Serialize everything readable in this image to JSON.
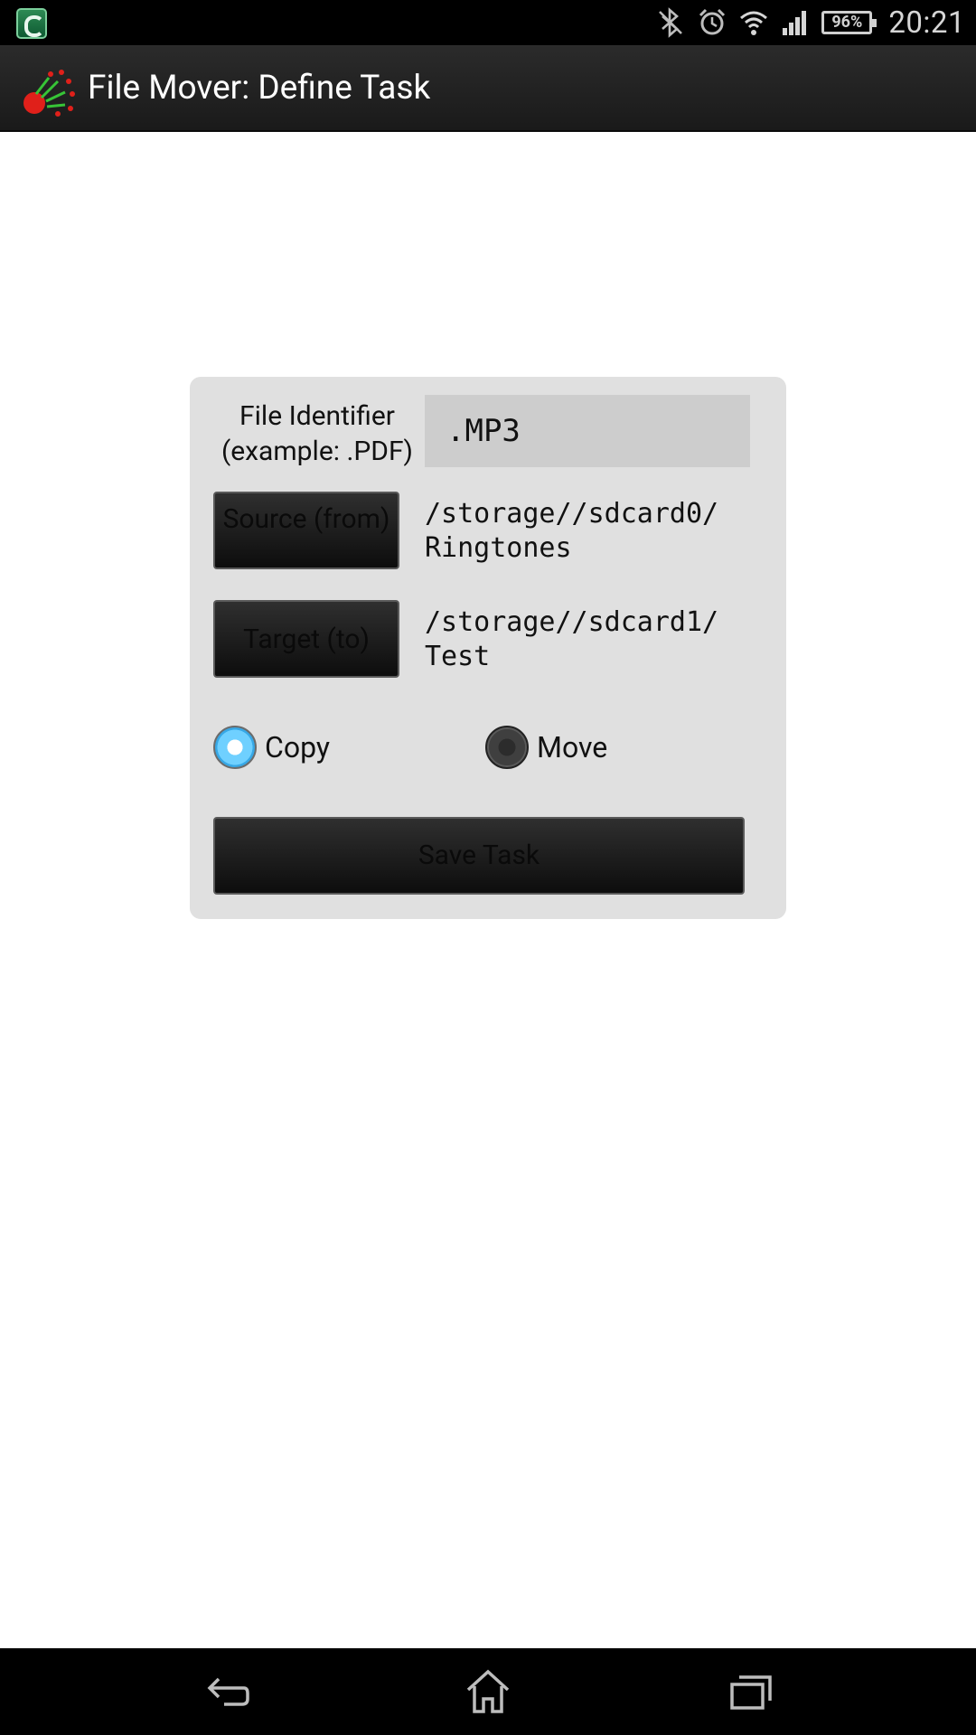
{
  "status_bar": {
    "left_icon": "app-notification-icon",
    "icons": [
      "bluetooth-off-icon",
      "alarm-icon",
      "wifi-icon",
      "signal-icon"
    ],
    "battery": "96%",
    "time": "20:21"
  },
  "action_bar": {
    "logo_icon": "app-logo-icon",
    "title": "File Mover: Define Task"
  },
  "form": {
    "file_identifier_label": "File Identifier (example: .PDF)",
    "file_identifier_value": ".MP3",
    "source_button": "Source (from)",
    "source_path": "/storage//sdcard0/\nRingtones",
    "target_button": "Target (to)",
    "target_path": "/storage//sdcard1/\nTest",
    "mode_options": {
      "copy": "Copy",
      "move": "Move",
      "selected": "Copy"
    },
    "save_button": "Save Task"
  },
  "nav_bar": {
    "buttons": [
      "back-icon",
      "home-icon",
      "recent-apps-icon"
    ]
  },
  "colors": {
    "status_bar": "#000000",
    "action_bar": "#222222",
    "card": "#e0e0e0",
    "radio_selected": "#5bc4f5"
  }
}
